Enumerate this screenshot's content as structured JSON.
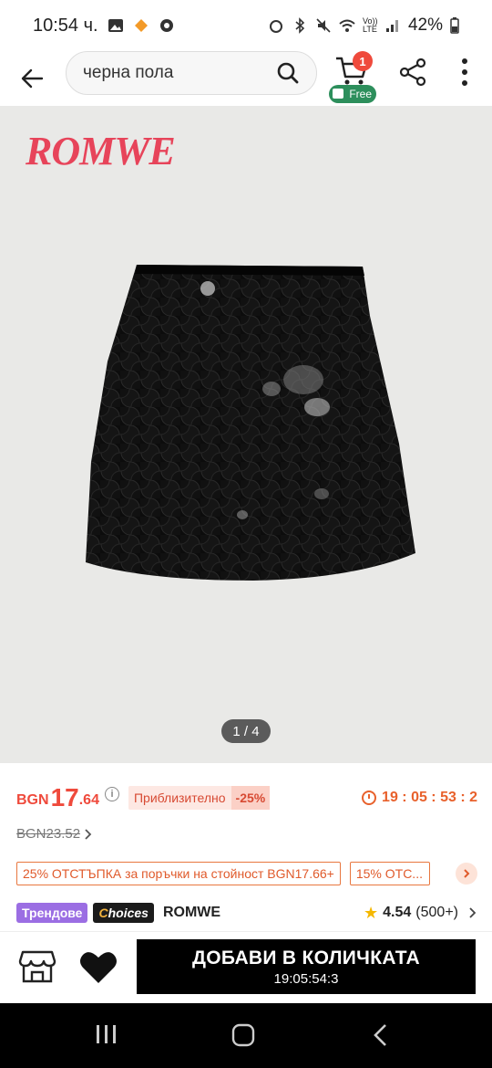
{
  "status_bar": {
    "time": "10:54 ч.",
    "battery": "42%",
    "network_label": "Vo)) LTE"
  },
  "nav": {
    "search_query": "черна пола",
    "cart_count": "1",
    "free_label": "Free"
  },
  "gallery": {
    "brand_logo": "ROMWE",
    "page_indicator": "1 / 4"
  },
  "price": {
    "currency": "BGN",
    "main": "17",
    "decimal": ".64",
    "approx_label": "Приблизително",
    "discount": "-25%",
    "countdown": "19 : 05 : 53 : 2",
    "original": "BGN23.52"
  },
  "coupons": [
    {
      "label": "25% ОТСТЪПКА за поръчки на стойност BGN17.66+"
    },
    {
      "label": "15% ОТС..."
    }
  ],
  "tags": {
    "trend": "Трендове",
    "choices_c": "C",
    "choices_rest": "hoices",
    "brand": "ROMWE"
  },
  "rating": {
    "value": "4.54",
    "count": "(500+)"
  },
  "action": {
    "add_to_cart": "ДОБАВИ В КОЛИЧКАТА",
    "countdown": "19:05:54:3"
  },
  "colors": {
    "accent_red": "#ef4a3c",
    "countdown_orange": "#e8612c",
    "trend_purple": "#9b6ee3",
    "free_green": "#2d8f5c"
  },
  "icons": [
    "back-arrow-icon",
    "search-icon",
    "cart-icon",
    "share-icon",
    "more-vert-icon",
    "info-icon",
    "clock-icon",
    "chevron-right-icon",
    "star-icon",
    "store-icon",
    "heart-icon",
    "recents-icon",
    "home-icon",
    "back-icon"
  ]
}
